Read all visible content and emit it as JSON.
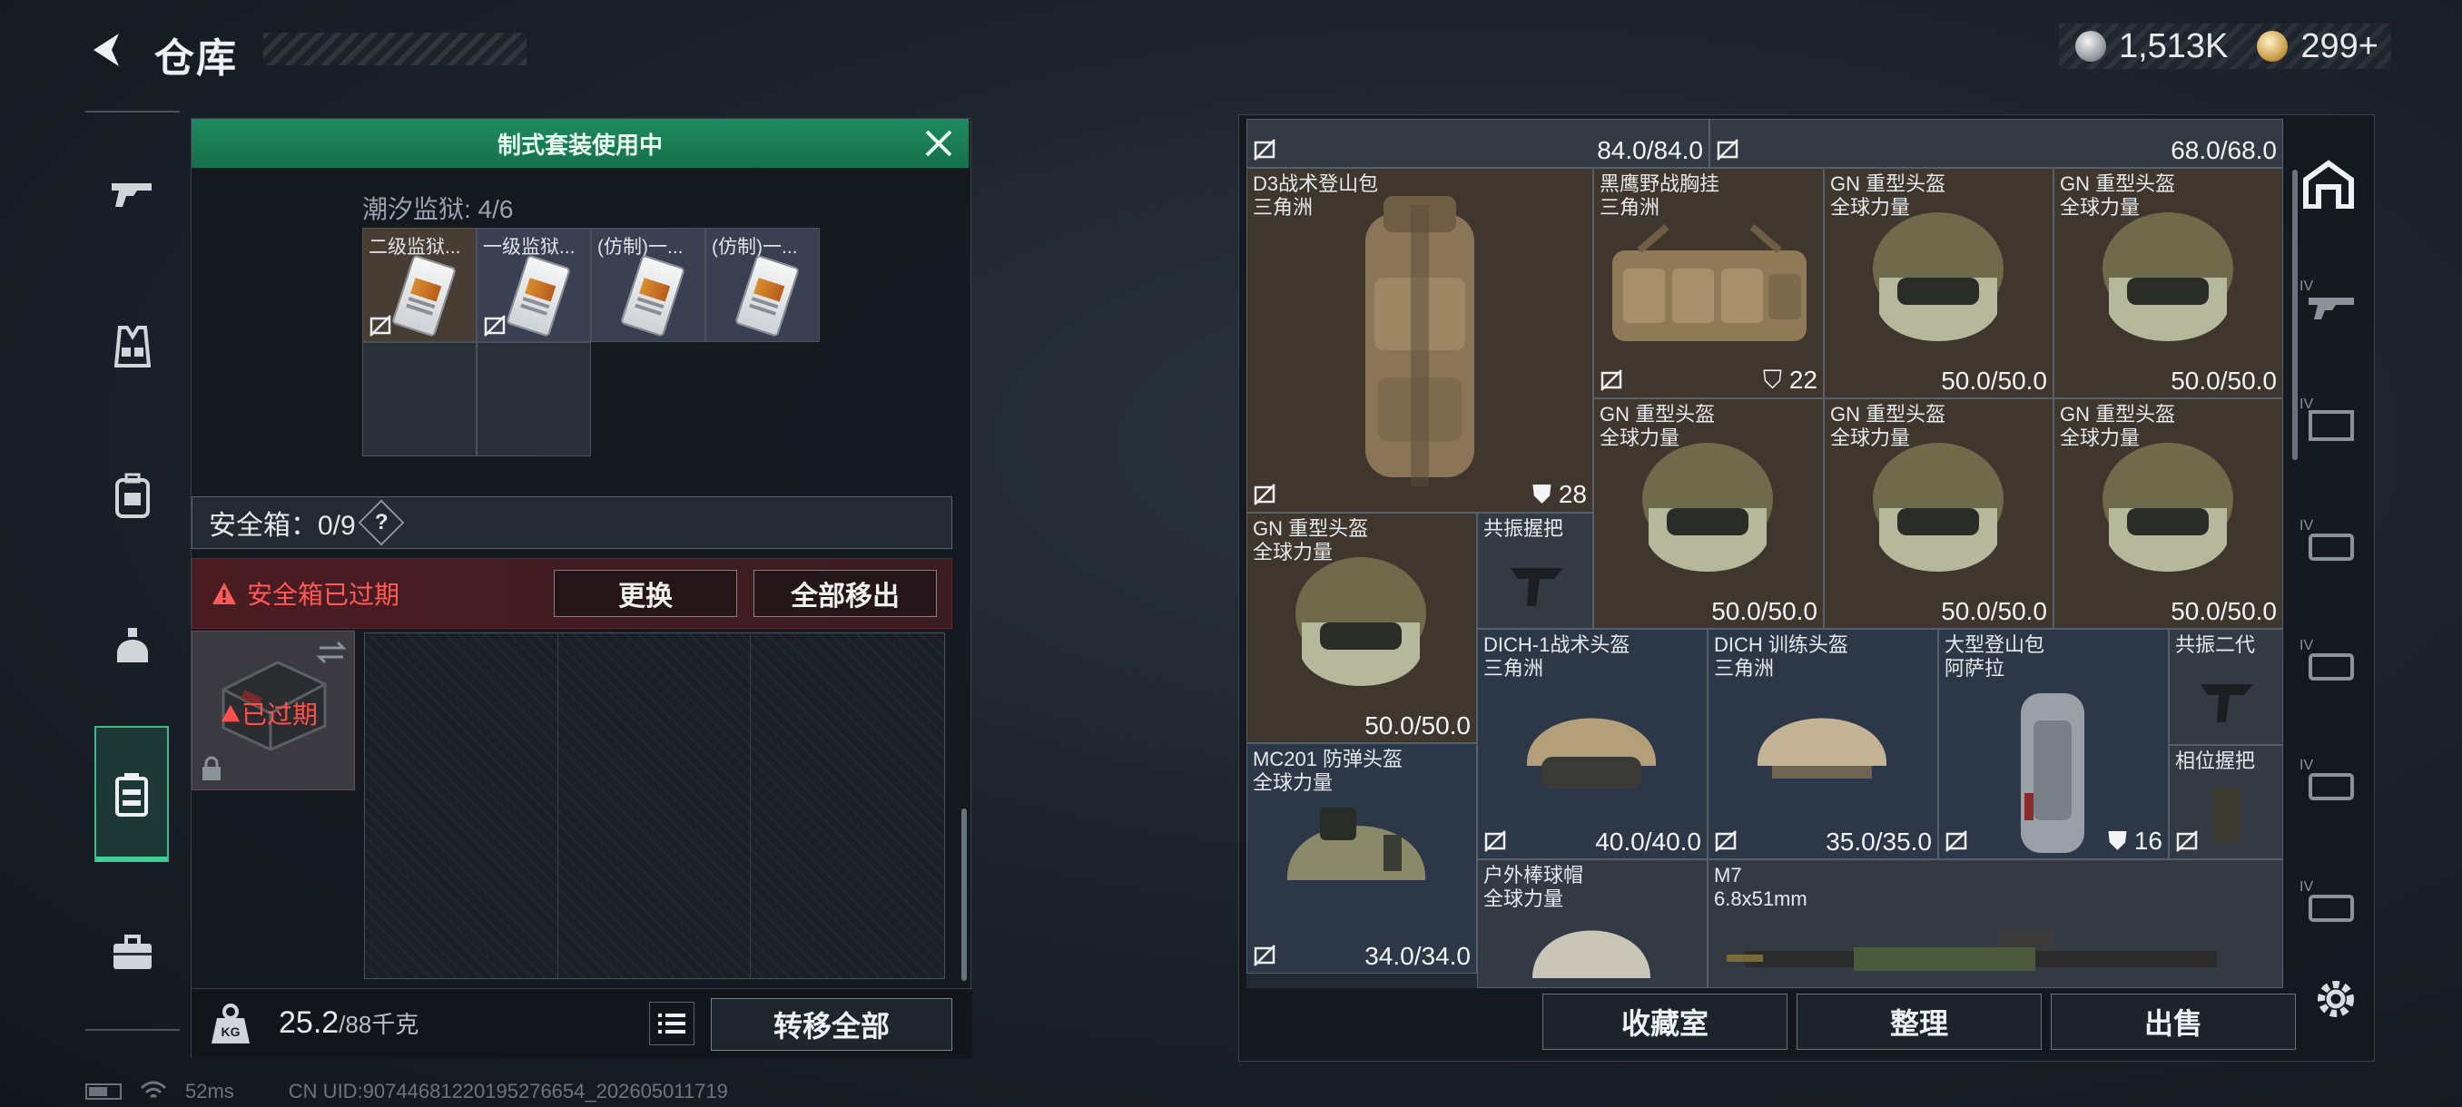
{
  "header": {
    "title": "仓库",
    "currency": [
      {
        "icon": "silver-coin-icon",
        "value": "1,513K"
      },
      {
        "icon": "gold-coin-icon",
        "value": "299+"
      }
    ]
  },
  "left_nav": [
    {
      "name": "weapons",
      "icon": "gun-icon"
    },
    {
      "name": "vests",
      "icon": "vest-icon"
    },
    {
      "name": "backpacks",
      "icon": "backpack-icon"
    },
    {
      "name": "helmets",
      "icon": "helmet-icon"
    },
    {
      "name": "safebox",
      "icon": "safebox-icon",
      "active": true
    },
    {
      "name": "cases",
      "icon": "briefcase-icon"
    }
  ],
  "left_panel": {
    "banner": "制式套装使用中",
    "tide_label": "潮汐监狱: 4/6",
    "set_cells": [
      {
        "label": "二级监狱...",
        "has_item": true
      },
      {
        "label": "一级监狱...",
        "has_item": true
      },
      {
        "label": "(仿制)一...",
        "has_item": true
      },
      {
        "label": "(仿制)一...",
        "has_item": true
      }
    ],
    "safebox_label": "安全箱：0/9",
    "help": "?",
    "expired_text": "安全箱已过期",
    "replace_btn": "更换",
    "removeall_btn": "全部移出",
    "safebox_item_label": "已过期",
    "weight_value": "25.2",
    "weight_max": "/88千克",
    "transfer_btn": "转移全部"
  },
  "inventory": {
    "top_row": [
      {
        "durability": "84.0/84.0"
      },
      {
        "durability": "68.0/68.0"
      }
    ],
    "items": [
      {
        "name1": "D3战术登山包",
        "name2": "三角洲",
        "count": "28",
        "art": "backpack"
      },
      {
        "name1": "黑鹰野战胸挂",
        "name2": "三角洲",
        "count": "22",
        "art": "vest"
      },
      {
        "name1": "GN 重型头盔",
        "name2": "全球力量",
        "durability": "50.0/50.0",
        "art": "heavy-helmet"
      },
      {
        "name1": "GN 重型头盔",
        "name2": "全球力量",
        "durability": "50.0/50.0",
        "art": "heavy-helmet"
      },
      {
        "name1": "GN 重型头盔",
        "name2": "全球力量",
        "durability": "50.0/50.0",
        "art": "heavy-helmet"
      },
      {
        "name1": "GN 重型头盔",
        "name2": "全球力量",
        "durability": "50.0/50.0",
        "art": "heavy-helmet"
      },
      {
        "name1": "GN 重型头盔",
        "name2": "全球力量",
        "durability": "50.0/50.0",
        "art": "heavy-helmet"
      },
      {
        "name1": "GN 重型头盔",
        "name2": "全球力量",
        "durability": "50.0/50.0",
        "art": "heavy-helmet"
      },
      {
        "name1": "共振握把",
        "name2": "",
        "art": "grip"
      },
      {
        "name1": "DICH-1战术头盔",
        "name2": "三角洲",
        "durability": "40.0/40.0",
        "art": "tac-helmet"
      },
      {
        "name1": "DICH 训练头盔",
        "name2": "三角洲",
        "durability": "35.0/35.0",
        "art": "train-helmet"
      },
      {
        "name1": "大型登山包",
        "name2": "阿萨拉",
        "count": "16",
        "art": "big-bag"
      },
      {
        "name1": "共振二代",
        "name2": "",
        "art": "grip"
      },
      {
        "name1": "相位握把",
        "name2": "",
        "art": "grip2"
      },
      {
        "name1": "MC201 防弹头盔",
        "name2": "全球力量",
        "durability": "34.0/34.0",
        "art": "mc-helmet"
      },
      {
        "name1": "户外棒球帽",
        "name2": "全球力量",
        "art": "cap"
      },
      {
        "name1": "M7",
        "name2": "6.8x51mm",
        "art": "rifle"
      }
    ]
  },
  "bottom_buttons": [
    "收藏室",
    "整理",
    "出售"
  ],
  "side_tabs": [
    {
      "icon": "home-icon"
    },
    {
      "icon": "tier4-gun-icon",
      "tier": "IV"
    },
    {
      "icon": "tier4-folder-icon",
      "tier": "IV"
    },
    {
      "icon": "tier4-case-icon",
      "tier": "IV"
    },
    {
      "icon": "tier4-case-icon",
      "tier": "IV"
    },
    {
      "icon": "tier4-case-icon",
      "tier": "IV"
    },
    {
      "icon": "tier4-case-icon",
      "tier": "IV"
    }
  ],
  "footer": {
    "ping": "52ms",
    "uid": "CN UID:9074468122019527665​4_202605011719"
  }
}
